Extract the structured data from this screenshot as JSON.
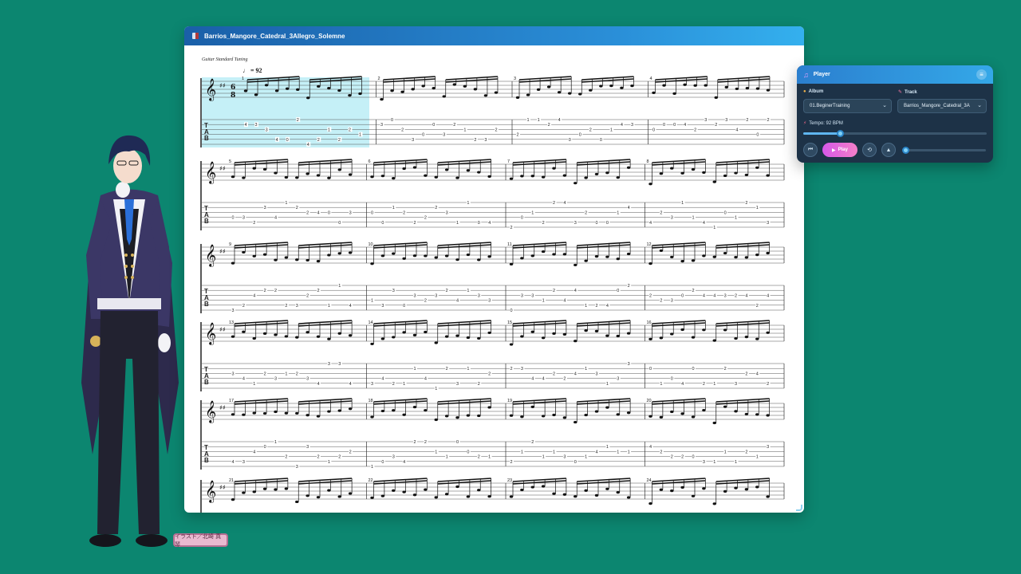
{
  "score": {
    "title": "Barrios_Mangore_Catedral_3Allegro_Solemne",
    "tuning": "Guitar Standard Tuning",
    "tempo_value": "= 92",
    "tab_letters": [
      "T",
      "A",
      "B"
    ],
    "systems": [
      {
        "measures": [
          1,
          2,
          3,
          4
        ]
      },
      {
        "measures": [
          5,
          6,
          7,
          8
        ]
      },
      {
        "measures": [
          9,
          10,
          11,
          12
        ]
      },
      {
        "measures": [
          13,
          14,
          15,
          16
        ]
      },
      {
        "measures": [
          17,
          18,
          19,
          20
        ]
      },
      {
        "measures": [
          21,
          22,
          23,
          24
        ]
      }
    ]
  },
  "credit": {
    "text": "イラスト／北崎 真琴"
  },
  "player": {
    "title": "Player",
    "album_label": "Album",
    "album_value": "01.BeginerTraining",
    "track_label": "Track",
    "track_value": "Barrios_Mangore_Catedral_3A",
    "tempo_label": "Tempo: 92 BPM",
    "tempo_bpm": 92,
    "tempo_fraction": 0.2,
    "progress_fraction": 0.0,
    "play_label": "Play",
    "colors": {
      "accent": "#34a8e8",
      "play": "#e06ad9",
      "panel": "#1d3247"
    }
  },
  "icons": {
    "music": "music-note-icon",
    "menu": "hamburger-menu-icon",
    "rewind": "skip-back-icon",
    "loop": "loop-icon",
    "metronome": "metronome-icon"
  }
}
